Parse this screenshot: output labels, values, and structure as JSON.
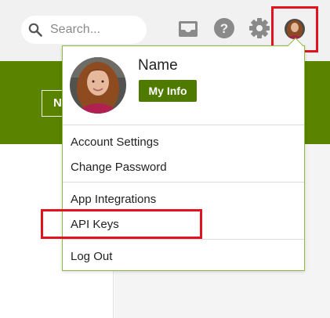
{
  "search": {
    "placeholder": "Search..."
  },
  "icons": {
    "search": "search-icon",
    "inbox": "inbox-icon",
    "help": "help-icon",
    "settings": "gear-icon",
    "avatar": "avatar"
  },
  "background": {
    "button_label": "N"
  },
  "profile_menu": {
    "name": "Name",
    "my_info_label": "My Info",
    "items": [
      "Account Settings",
      "Change Password",
      "App Integrations",
      "API Keys",
      "Log Out"
    ]
  },
  "colors": {
    "brand_green": "#5a8300",
    "button_green": "#4e7a00",
    "dropdown_border": "#8dbb3a",
    "highlight_red": "#e0131f",
    "topbar_bg": "#f1f1f1"
  }
}
